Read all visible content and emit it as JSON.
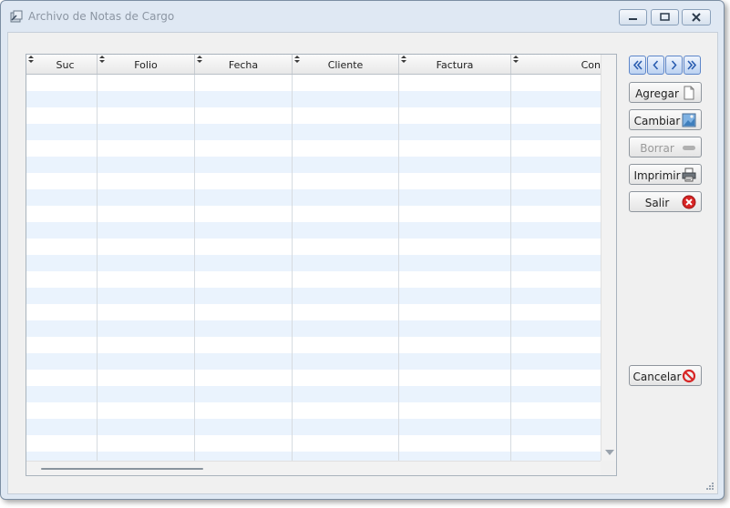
{
  "window": {
    "title": "Archivo de Notas de Cargo"
  },
  "grid": {
    "columns": [
      {
        "label": "Suc"
      },
      {
        "label": "Folio"
      },
      {
        "label": "Fecha"
      },
      {
        "label": "Cliente"
      },
      {
        "label": "Factura"
      },
      {
        "label": "Con"
      }
    ],
    "rows": []
  },
  "navigation": {
    "first": "first-record-icon",
    "previous": "previous-record-icon",
    "next": "next-record-icon",
    "last": "last-record-icon"
  },
  "buttons": {
    "agregar": "Agregar",
    "cambiar": "Cambiar",
    "borrar": "Borrar",
    "imprimir": "Imprimir",
    "salir": "Salir",
    "cancelar": "Cancelar"
  },
  "colors": {
    "row_alt": "#eaf3fd",
    "nav_accent": "#2a5db0",
    "exit_red": "#d72525"
  }
}
